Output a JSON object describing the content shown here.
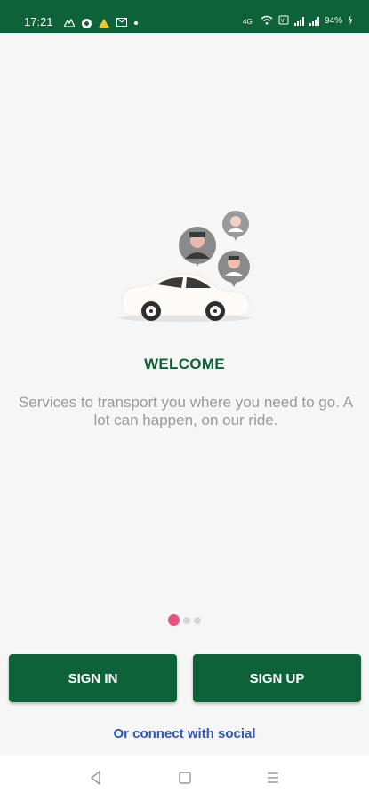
{
  "status_bar": {
    "time": "17:21",
    "battery": "94%",
    "icons_left": [
      "terrain-icon",
      "record-icon",
      "warning-icon",
      "mail-icon",
      "dot-icon"
    ],
    "icons_right": [
      "data-icon",
      "wifi-icon",
      "volte-icon",
      "signal-icon",
      "signal-icon",
      "battery-icon"
    ]
  },
  "onboarding": {
    "title": "WELCOME",
    "description": "Services to transport you where you need to go. A lot can happen, on our ride.",
    "page_count": 3,
    "active_page": 1
  },
  "actions": {
    "sign_in_label": "SIGN IN",
    "sign_up_label": "SIGN UP",
    "social_label": "Or connect with social"
  },
  "colors": {
    "primary": "#0d6239",
    "accent": "#e75480",
    "link": "#2f56b8"
  }
}
